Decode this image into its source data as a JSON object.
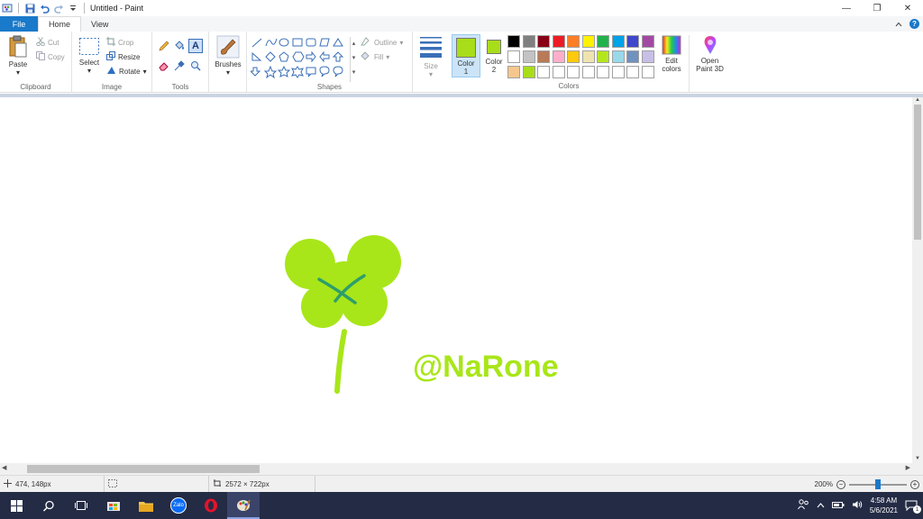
{
  "window": {
    "title": "Untitled - Paint",
    "controls": {
      "minimize": "—",
      "restore": "❐",
      "close": "✕"
    }
  },
  "menu": {
    "tabs": [
      {
        "label": "File"
      },
      {
        "label": "Home"
      },
      {
        "label": "View"
      }
    ]
  },
  "ribbon": {
    "clipboard": {
      "paste": "Paste",
      "cut": "Cut",
      "copy": "Copy",
      "label": "Clipboard"
    },
    "image": {
      "select": "Select",
      "crop": "Crop",
      "resize": "Resize",
      "rotate": "Rotate",
      "label": "Image"
    },
    "tools": {
      "label": "Tools"
    },
    "brushes": {
      "label": "Brushes"
    },
    "shapes": {
      "outline": "Outline",
      "fill": "Fill",
      "label": "Shapes"
    },
    "size": {
      "label": "Size"
    },
    "color1": {
      "label": "Color",
      "number": "1",
      "value": "#a8dd19"
    },
    "color2": {
      "label": "Color",
      "number": "2",
      "value": "#a8dd19"
    },
    "colors": {
      "label": "Colors",
      "edit_line1": "Edit",
      "edit_line2": "colors"
    },
    "paint3d": {
      "line1": "Open",
      "line2": "Paint 3D"
    }
  },
  "palette": {
    "row1": [
      "#000000",
      "#7f7f7f",
      "#880015",
      "#ed1c24",
      "#ff7f27",
      "#fff200",
      "#22b14c",
      "#00a2e8",
      "#3f48cc",
      "#a349a4"
    ],
    "row2": [
      "#ffffff",
      "#c3c3c3",
      "#b97a57",
      "#ffaec9",
      "#ffc90e",
      "#efe4b0",
      "#b5e61d",
      "#99d9ea",
      "#7092be",
      "#c8bfe7"
    ],
    "row3": [
      "#f5c78e",
      "#a8dd19",
      "#ffffff",
      "#ffffff",
      "#ffffff",
      "#ffffff",
      "#ffffff",
      "#ffffff",
      "#ffffff",
      "#ffffff"
    ]
  },
  "canvas": {
    "watermark_text": "@NaRone",
    "clover_color": "#a8e619",
    "mark_color": "#2e9e6a"
  },
  "status": {
    "cursor": "474, 148px",
    "size": "2572 × 722px",
    "zoom": "200%",
    "zoom_level": 0.5
  },
  "taskbar": {
    "time": "4:58 AM",
    "date": "5/6/2021",
    "zalo": "Zalo",
    "notifications": "1"
  }
}
